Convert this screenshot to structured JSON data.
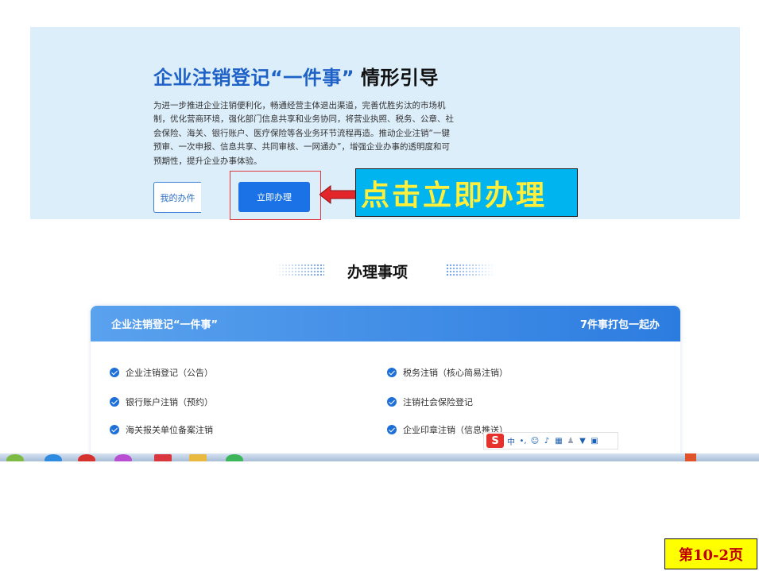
{
  "hero": {
    "title_part1": "企业注销登记“一件事”",
    "title_part2": "情形引导",
    "description": "为进一步推进企业注销便利化，畅通经营主体退出渠道，完善优胜劣汰的市场机制，优化营商环境，强化部门信息共享和业务协同，将营业执照、税务、公章、社会保险、海关、银行账户、医疗保险等各业务环节流程再造。推动企业注销“一键预审、一次申报、信息共享、共同审核、一网通办”，增强企业办事的透明度和可预期性，提升企业办事体验。",
    "my_items_button": "我的办件",
    "apply_button": "立即办理"
  },
  "callout": {
    "text": "点击立即办理"
  },
  "section": {
    "title": "办理事项"
  },
  "card": {
    "title": "企业注销登记“一件事”",
    "badge": "7件事打包一起办",
    "items": [
      "企业注销登记（公告）",
      "税务注销（核心简易注销）",
      "银行账户注销（预约）",
      "注销社会保险登记",
      "海关报关单位备案注销",
      "企业印章注销（信息推送）"
    ]
  },
  "ime": {
    "logo": "S",
    "mode": "中"
  },
  "page_label": "第10-2页",
  "colors": {
    "primary": "#1a72e6",
    "hero_bg": "#ddeefb",
    "callout_bg": "#00b4f0",
    "callout_text": "#ffef3a",
    "highlight": "#e0373c"
  }
}
